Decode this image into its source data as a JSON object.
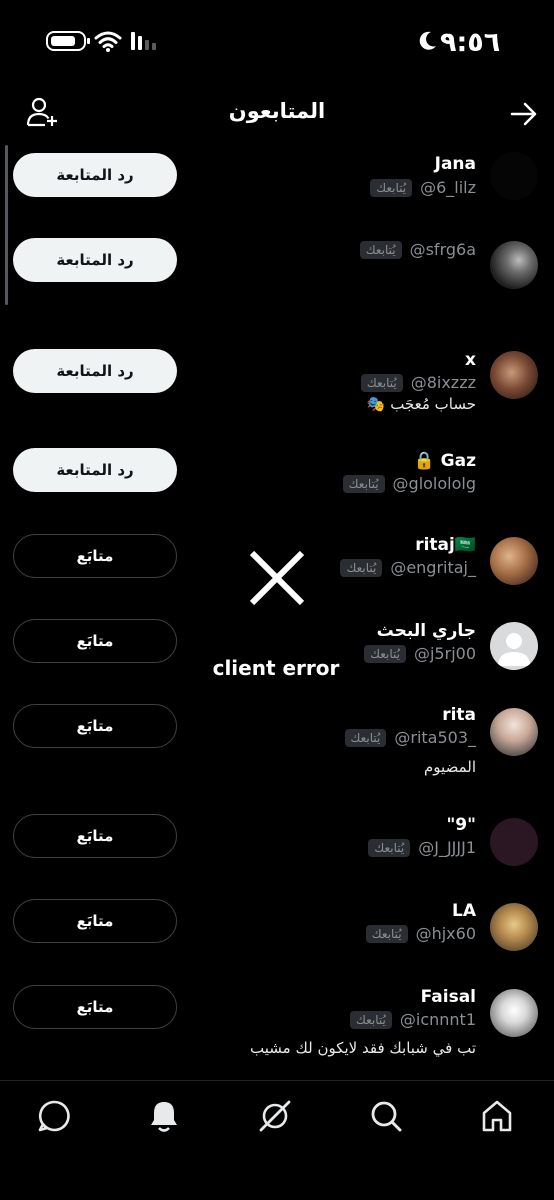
{
  "status_bar": {
    "time": "٩:٥٦",
    "icons": [
      "battery-icon",
      "wifi-icon",
      "cellular-signal-icon",
      "moon-icon"
    ]
  },
  "header": {
    "title": "المتابعون",
    "left_icon": "add-user-icon",
    "right_icon": "back-arrow-icon"
  },
  "followers": [
    {
      "name": "Jana",
      "handle": "@6_lilz",
      "follows_you": "يُتابعك",
      "bio": "",
      "button": "رد المتابعة"
    },
    {
      "name": "",
      "handle": "@sfrg6a",
      "follows_you": "يُتابعك",
      "bio": "",
      "button": "رد المتابعة"
    },
    {
      "name": "x",
      "handle": "@8ixzzz",
      "follows_you": "يُتابعك",
      "bio": "🎭 حساب مُعجَب",
      "button": "رد المتابعة"
    },
    {
      "name": "🔒 Gaz",
      "handle": "@glolololg",
      "follows_you": "يُتابعك",
      "bio": "",
      "button": "رد المتابعة"
    },
    {
      "name": "ritaj🇸🇦",
      "handle": "@engritaj_",
      "follows_you": "يُتابعك",
      "bio": "",
      "button": "متابَع"
    },
    {
      "name": "جاري البحث",
      "handle": "@j5rj00",
      "follows_you": "يُتابعك",
      "bio": "",
      "button": "متابَع"
    },
    {
      "name": "rita",
      "handle": "@rita503_",
      "follows_you": "يُتابعك",
      "bio": "المضيوم",
      "button": "متابَع"
    },
    {
      "name": "\"9\"",
      "handle": "@J_JJJJ1",
      "follows_you": "يُتابعك",
      "bio": "",
      "button": "متابَع"
    },
    {
      "name": "LA",
      "handle": "@hjx60",
      "follows_you": "يُتابعك",
      "bio": "",
      "button": "متابَع"
    },
    {
      "name": "Faisal",
      "handle": "@icnnnt1",
      "follows_you": "يُتابعك",
      "bio": "تب في شبابك فقد لايكون لك مشيب",
      "button": "متابَع"
    }
  ],
  "error_overlay": {
    "icon": "close-x-icon",
    "message": "client error"
  },
  "bottom_nav": {
    "items": [
      "home-icon",
      "search-icon",
      "grok-icon",
      "notifications-bell-icon",
      "messages-icon"
    ]
  },
  "colors": {
    "background": "#000000",
    "primary_text": "#e7e9ea",
    "secondary_text": "#8b8f94",
    "badge_bg": "#2a2d31",
    "light_button_bg": "#eff3f4"
  }
}
